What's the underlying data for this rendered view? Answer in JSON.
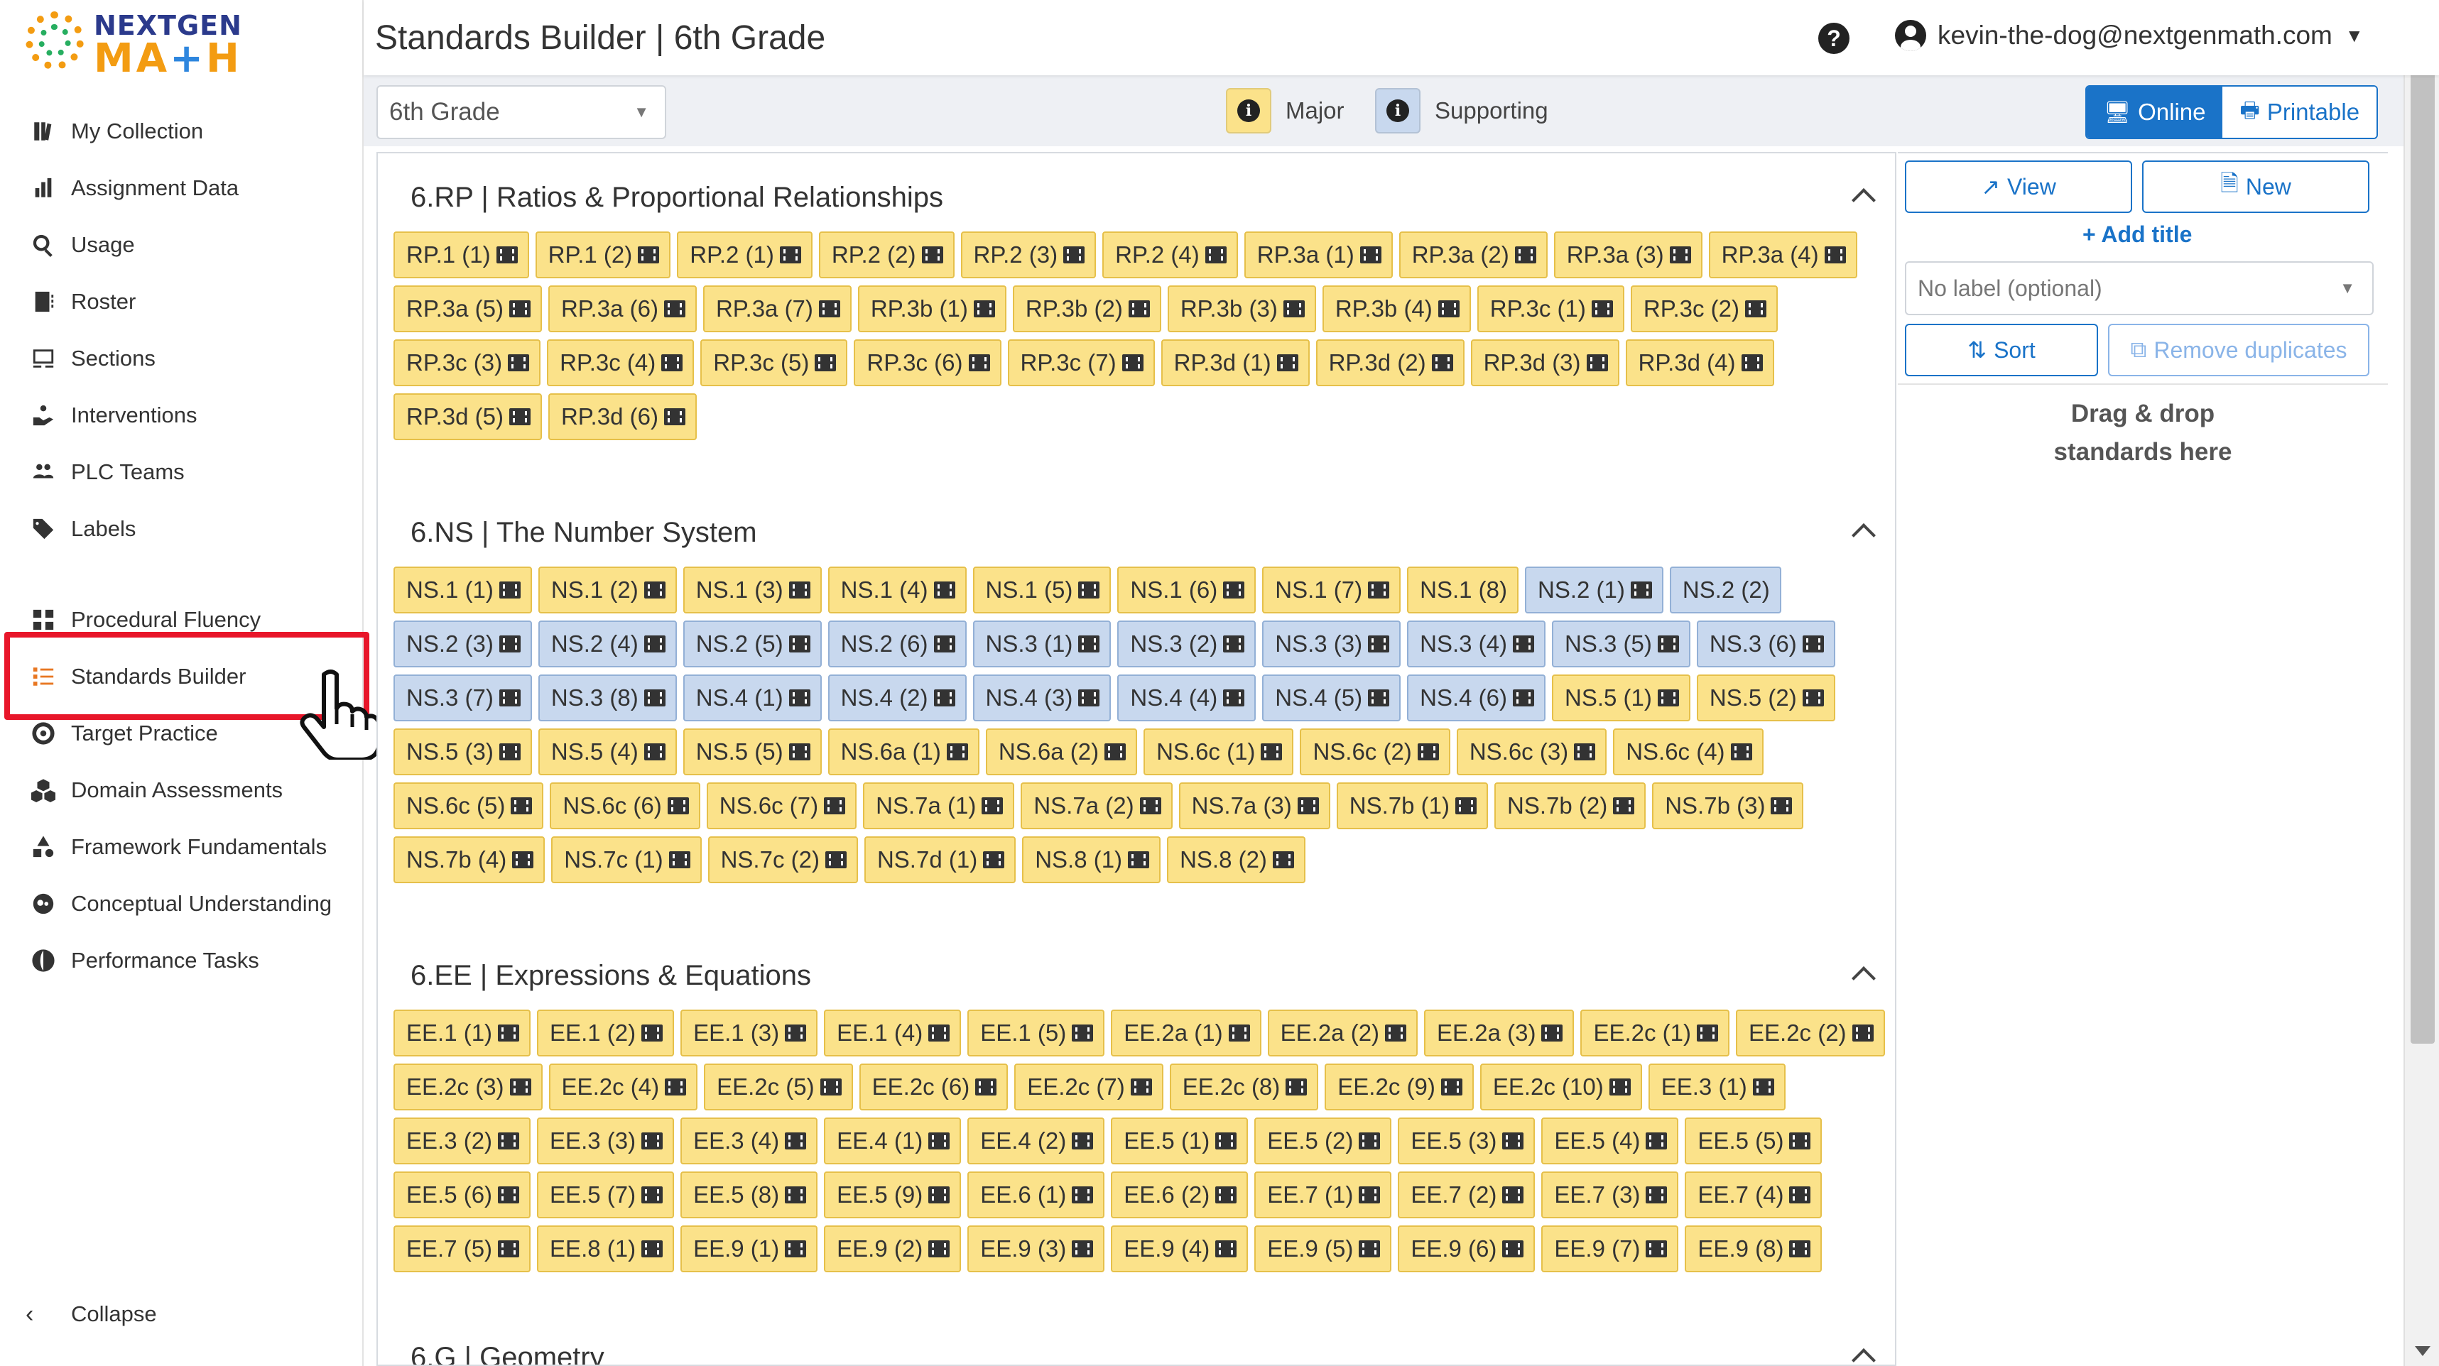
{
  "app": {
    "logo_top": "NEXTGEN",
    "logo_bottom_a": "M",
    "logo_bottom_b": "A",
    "logo_bottom_c": "+",
    "logo_bottom_d": "H"
  },
  "header": {
    "title": "Standards Builder | 6th Grade",
    "help": "?",
    "user_email": "kevin-the-dog@nextgenmath.com"
  },
  "sidebar": {
    "items": [
      {
        "label": "My Collection",
        "icon": "books-icon"
      },
      {
        "label": "Assignment Data",
        "icon": "bar-chart-icon"
      },
      {
        "label": "Usage",
        "icon": "magnify-chart-icon"
      },
      {
        "label": "Roster",
        "icon": "address-book-icon"
      },
      {
        "label": "Sections",
        "icon": "chalkboard-icon"
      },
      {
        "label": "Interventions",
        "icon": "hand-holding-icon"
      },
      {
        "label": "PLC Teams",
        "icon": "users-icon"
      },
      {
        "label": "Labels",
        "icon": "tag-icon"
      },
      {
        "label": "Procedural Fluency",
        "icon": "grid-icon"
      },
      {
        "label": "Standards Builder",
        "icon": "list-builder-icon"
      },
      {
        "label": "Target Practice",
        "icon": "bullseye-icon"
      },
      {
        "label": "Domain Assessments",
        "icon": "cubes-icon"
      },
      {
        "label": "Framework Fundamentals",
        "icon": "shapes-icon"
      },
      {
        "label": "Conceptual Understanding",
        "icon": "brain-icon"
      },
      {
        "label": "Performance Tasks",
        "icon": "globe-icon"
      }
    ],
    "collapse_label": "Collapse"
  },
  "toolbar": {
    "grade_value": "6th Grade",
    "legend_major": "Major",
    "legend_supporting": "Supporting",
    "legend_info_glyph": "i",
    "online_label": "Online",
    "printable_label": "Printable",
    "colors": {
      "major": "#fbe28a",
      "supporting": "#c8d8ee",
      "accent": "#1a73c8",
      "highlight": "#e8162a"
    }
  },
  "right_panel": {
    "view_label": "View",
    "new_label": "New",
    "add_title_label": "+ Add title",
    "label_placeholder": "No label (optional)",
    "sort_label": "Sort",
    "remove_duplicates_label": "Remove duplicates",
    "drop_line1": "Drag & drop",
    "drop_line2": "standards here"
  },
  "sections": [
    {
      "title": "6.RP | Ratios & Proportional Relationships",
      "rows": [
        [
          [
            "RP.1 (1)",
            "M"
          ],
          [
            "RP.1 (2)",
            "M"
          ],
          [
            "RP.2 (1)",
            "M"
          ],
          [
            "RP.2 (2)",
            "M"
          ],
          [
            "RP.2 (3)",
            "M"
          ],
          [
            "RP.2 (4)",
            "M"
          ],
          [
            "RP.3a (1)",
            "M"
          ],
          [
            "RP.3a (2)",
            "M"
          ],
          [
            "RP.3a (3)",
            "M"
          ],
          [
            "RP.3a (4)",
            "M"
          ]
        ],
        [
          [
            "RP.3a (5)",
            "M"
          ],
          [
            "RP.3a (6)",
            "M"
          ],
          [
            "RP.3a (7)",
            "M"
          ],
          [
            "RP.3b (1)",
            "M"
          ],
          [
            "RP.3b (2)",
            "M"
          ],
          [
            "RP.3b (3)",
            "M"
          ],
          [
            "RP.3b (4)",
            "M"
          ],
          [
            "RP.3c (1)",
            "M"
          ],
          [
            "RP.3c (2)",
            "M"
          ]
        ],
        [
          [
            "RP.3c (3)",
            "M"
          ],
          [
            "RP.3c (4)",
            "M"
          ],
          [
            "RP.3c (5)",
            "M"
          ],
          [
            "RP.3c (6)",
            "M"
          ],
          [
            "RP.3c (7)",
            "M"
          ],
          [
            "RP.3d (1)",
            "M"
          ],
          [
            "RP.3d (2)",
            "M"
          ],
          [
            "RP.3d (3)",
            "M"
          ],
          [
            "RP.3d (4)",
            "M"
          ]
        ],
        [
          [
            "RP.3d (5)",
            "M"
          ],
          [
            "RP.3d (6)",
            "M"
          ]
        ]
      ]
    },
    {
      "title": "6.NS | The Number System",
      "rows": [
        [
          [
            "NS.1 (1)",
            "M"
          ],
          [
            "NS.1 (2)",
            "M"
          ],
          [
            "NS.1 (3)",
            "M"
          ],
          [
            "NS.1 (4)",
            "M"
          ],
          [
            "NS.1 (5)",
            "M"
          ],
          [
            "NS.1 (6)",
            "M"
          ],
          [
            "NS.1 (7)",
            "M"
          ],
          [
            "NS.1 (8)",
            "M0"
          ],
          [
            "NS.2 (1)",
            "S"
          ],
          [
            "NS.2 (2)",
            "S0"
          ]
        ],
        [
          [
            "NS.2 (3)",
            "S"
          ],
          [
            "NS.2 (4)",
            "S"
          ],
          [
            "NS.2 (5)",
            "S"
          ],
          [
            "NS.2 (6)",
            "S"
          ],
          [
            "NS.3 (1)",
            "S"
          ],
          [
            "NS.3 (2)",
            "S"
          ],
          [
            "NS.3 (3)",
            "S"
          ],
          [
            "NS.3 (4)",
            "S"
          ],
          [
            "NS.3 (5)",
            "S"
          ],
          [
            "NS.3 (6)",
            "S"
          ]
        ],
        [
          [
            "NS.3 (7)",
            "S"
          ],
          [
            "NS.3 (8)",
            "S"
          ],
          [
            "NS.4 (1)",
            "S"
          ],
          [
            "NS.4 (2)",
            "S"
          ],
          [
            "NS.4 (3)",
            "S"
          ],
          [
            "NS.4 (4)",
            "S"
          ],
          [
            "NS.4 (5)",
            "S"
          ],
          [
            "NS.4 (6)",
            "S"
          ],
          [
            "NS.5 (1)",
            "M"
          ],
          [
            "NS.5 (2)",
            "M"
          ]
        ],
        [
          [
            "NS.5 (3)",
            "M"
          ],
          [
            "NS.5 (4)",
            "M"
          ],
          [
            "NS.5 (5)",
            "M"
          ],
          [
            "NS.6a (1)",
            "M"
          ],
          [
            "NS.6a (2)",
            "M"
          ],
          [
            "NS.6c (1)",
            "M"
          ],
          [
            "NS.6c (2)",
            "M"
          ],
          [
            "NS.6c (3)",
            "M"
          ],
          [
            "NS.6c (4)",
            "M"
          ]
        ],
        [
          [
            "NS.6c (5)",
            "M"
          ],
          [
            "NS.6c (6)",
            "M"
          ],
          [
            "NS.6c (7)",
            "M"
          ],
          [
            "NS.7a (1)",
            "M"
          ],
          [
            "NS.7a (2)",
            "M"
          ],
          [
            "NS.7a (3)",
            "M"
          ],
          [
            "NS.7b (1)",
            "M"
          ],
          [
            "NS.7b (2)",
            "M"
          ],
          [
            "NS.7b (3)",
            "M"
          ]
        ],
        [
          [
            "NS.7b (4)",
            "M"
          ],
          [
            "NS.7c (1)",
            "M"
          ],
          [
            "NS.7c (2)",
            "M"
          ],
          [
            "NS.7d (1)",
            "M"
          ],
          [
            "NS.8 (1)",
            "M"
          ],
          [
            "NS.8 (2)",
            "M"
          ]
        ]
      ]
    },
    {
      "title": "6.EE | Expressions & Equations",
      "rows": [
        [
          [
            "EE.1 (1)",
            "M"
          ],
          [
            "EE.1 (2)",
            "M"
          ],
          [
            "EE.1 (3)",
            "M"
          ],
          [
            "EE.1 (4)",
            "M"
          ],
          [
            "EE.1 (5)",
            "M"
          ],
          [
            "EE.2a (1)",
            "M"
          ],
          [
            "EE.2a (2)",
            "M"
          ],
          [
            "EE.2a (3)",
            "M"
          ],
          [
            "EE.2c (1)",
            "M"
          ],
          [
            "EE.2c (2)",
            "M"
          ]
        ],
        [
          [
            "EE.2c (3)",
            "M"
          ],
          [
            "EE.2c (4)",
            "M"
          ],
          [
            "EE.2c (5)",
            "M"
          ],
          [
            "EE.2c (6)",
            "M"
          ],
          [
            "EE.2c (7)",
            "M"
          ],
          [
            "EE.2c (8)",
            "M"
          ],
          [
            "EE.2c (9)",
            "M"
          ],
          [
            "EE.2c (10)",
            "M"
          ],
          [
            "EE.3 (1)",
            "M"
          ]
        ],
        [
          [
            "EE.3 (2)",
            "M"
          ],
          [
            "EE.3 (3)",
            "M"
          ],
          [
            "EE.3 (4)",
            "M"
          ],
          [
            "EE.4 (1)",
            "M"
          ],
          [
            "EE.4 (2)",
            "M"
          ],
          [
            "EE.5 (1)",
            "M"
          ],
          [
            "EE.5 (2)",
            "M"
          ],
          [
            "EE.5 (3)",
            "M"
          ],
          [
            "EE.5 (4)",
            "M"
          ],
          [
            "EE.5 (5)",
            "M"
          ]
        ],
        [
          [
            "EE.5 (6)",
            "M"
          ],
          [
            "EE.5 (7)",
            "M"
          ],
          [
            "EE.5 (8)",
            "M"
          ],
          [
            "EE.5 (9)",
            "M"
          ],
          [
            "EE.6 (1)",
            "M"
          ],
          [
            "EE.6 (2)",
            "M"
          ],
          [
            "EE.7 (1)",
            "M"
          ],
          [
            "EE.7 (2)",
            "M"
          ],
          [
            "EE.7 (3)",
            "M"
          ],
          [
            "EE.7 (4)",
            "M"
          ]
        ],
        [
          [
            "EE.7 (5)",
            "M"
          ],
          [
            "EE.8 (1)",
            "M"
          ],
          [
            "EE.9 (1)",
            "M"
          ],
          [
            "EE.9 (2)",
            "M"
          ],
          [
            "EE.9 (3)",
            "M"
          ],
          [
            "EE.9 (4)",
            "M"
          ],
          [
            "EE.9 (5)",
            "M"
          ],
          [
            "EE.9 (6)",
            "M"
          ],
          [
            "EE.9 (7)",
            "M"
          ],
          [
            "EE.9 (8)",
            "M"
          ]
        ]
      ]
    },
    {
      "title": "6.G | Geometry",
      "rows": []
    }
  ]
}
